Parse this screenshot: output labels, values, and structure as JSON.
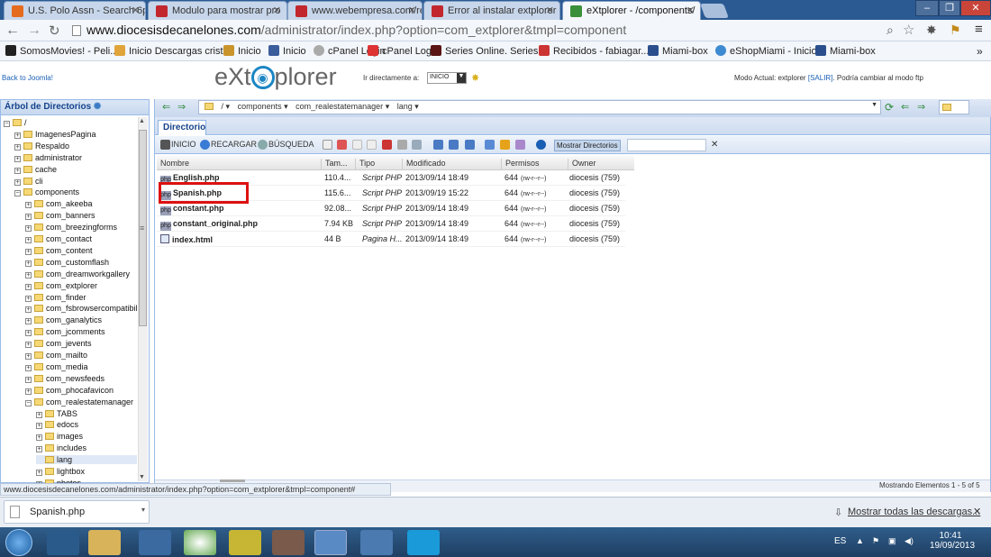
{
  "browser": {
    "tabs": [
      {
        "title": "U.S. Polo Assn - Search 6p",
        "fav_color": "#e56b1f"
      },
      {
        "title": "Modulo para mostrar pro",
        "fav_color": "#c2272d"
      },
      {
        "title": "www.webempresa.com/re",
        "fav_color": "#c2272d"
      },
      {
        "title": "Error al instalar extplorer -",
        "fav_color": "#c2272d"
      },
      {
        "title": "eXtplorer - /components/",
        "fav_color": "#3a8f3a"
      }
    ],
    "url_domain": "www.diocesisdecanelones.com",
    "url_rest": "/administrator/index.php?option=com_extplorer&tmpl=component",
    "bookmarks": [
      "SomosMovies! - Peli...",
      "Inicio Descargas cristo",
      "Inicio",
      "Inicio",
      "cPanel Login",
      "Series Online. Series...",
      "Recibidos - fabiagar...",
      "Miami-box",
      "eShopMiami - Inicio",
      "Miami-box"
    ],
    "overflow": "»"
  },
  "page": {
    "back_link": "Back to Joomla!",
    "logo": {
      "pre": "eXt",
      "o": "◉",
      "post": "plorer"
    },
    "goto_label": "Ir directamente a:",
    "goto_value": "INICIO",
    "mode_text": "Modo Actual: extplorer",
    "mode_salir": "[SALIR]",
    "mode_tail": "Podría cambiar al modo ftp"
  },
  "tree": {
    "title": "Árbol de Directorios",
    "nodes": [
      {
        "label": "/",
        "sign": "−"
      },
      {
        "label": "ImagenesPagina",
        "sign": "+"
      },
      {
        "label": "Respaldo",
        "sign": "+"
      },
      {
        "label": "administrator",
        "sign": "+"
      },
      {
        "label": "cache",
        "sign": "+"
      },
      {
        "label": "cli",
        "sign": "+"
      },
      {
        "label": "components",
        "sign": "−"
      },
      {
        "label": "com_akeeba",
        "sign": "+"
      },
      {
        "label": "com_banners",
        "sign": "+"
      },
      {
        "label": "com_breezingforms",
        "sign": "+"
      },
      {
        "label": "com_contact",
        "sign": "+"
      },
      {
        "label": "com_content",
        "sign": "+"
      },
      {
        "label": "com_customflash",
        "sign": "+"
      },
      {
        "label": "com_dreamworkgallery",
        "sign": "+"
      },
      {
        "label": "com_extplorer",
        "sign": "+"
      },
      {
        "label": "com_finder",
        "sign": "+"
      },
      {
        "label": "com_fsbrowsercompatibility",
        "sign": "+"
      },
      {
        "label": "com_ganalytics",
        "sign": "+"
      },
      {
        "label": "com_jcomments",
        "sign": "+"
      },
      {
        "label": "com_jevents",
        "sign": "+"
      },
      {
        "label": "com_mailto",
        "sign": "+"
      },
      {
        "label": "com_media",
        "sign": "+"
      },
      {
        "label": "com_newsfeeds",
        "sign": "+"
      },
      {
        "label": "com_phocafavicon",
        "sign": "+"
      },
      {
        "label": "com_realestatemanager",
        "sign": "−"
      },
      {
        "label": "TABS",
        "sign": "+"
      },
      {
        "label": "edocs",
        "sign": "+"
      },
      {
        "label": "images",
        "sign": "+"
      },
      {
        "label": "includes",
        "sign": "+"
      },
      {
        "label": "lang",
        "sign": ""
      },
      {
        "label": "lightbox",
        "sign": "+"
      },
      {
        "label": "photos",
        "sign": "+"
      }
    ]
  },
  "breadcrumb": [
    "/",
    "components",
    "com_realestatemanager",
    "lang"
  ],
  "panel_tab": "Directorio",
  "toolbar": {
    "inicio": "INICIO",
    "recargar": "RECARGAR",
    "busqueda": "BÚSQUEDA",
    "mostrar": "Mostrar Directorios"
  },
  "grid": {
    "headers": [
      "Nombre",
      "Tam...",
      "Tipo",
      "Modificado",
      "Permisos",
      "Owner"
    ],
    "rows": [
      {
        "name": "English.php",
        "size": "110.4...",
        "type": "Script PHP",
        "modified": "2013/09/14 18:49",
        "perm": "644",
        "perm_detail": "(rw-r--r--)",
        "owner": "diocesis (759)",
        "icon": "php"
      },
      {
        "name": "Spanish.php",
        "size": "115.6...",
        "type": "Script PHP",
        "modified": "2013/09/19 15:22",
        "perm": "644",
        "perm_detail": "(rw-r--r--)",
        "owner": "diocesis (759)",
        "icon": "php"
      },
      {
        "name": "constant.php",
        "size": "92.08...",
        "type": "Script PHP",
        "modified": "2013/09/14 18:49",
        "perm": "644",
        "perm_detail": "(rw-r--r--)",
        "owner": "diocesis (759)",
        "icon": "php"
      },
      {
        "name": "constant_original.php",
        "size": "7.94 KB",
        "type": "Script PHP",
        "modified": "2013/09/14 18:49",
        "perm": "644",
        "perm_detail": "(rw-r--r--)",
        "owner": "diocesis (759)",
        "icon": "php"
      },
      {
        "name": "index.html",
        "size": "44 B",
        "type": "Pagina H...",
        "modified": "2013/09/14 18:49",
        "perm": "644",
        "perm_detail": "(rw-r--r--)",
        "owner": "diocesis (759)",
        "icon": "html"
      }
    ],
    "icon_label": "php"
  },
  "status_text": "Mostrando Elementos 1 - 5 of 5",
  "hover_url": "www.diocesisdecanelones.com/administrator/index.php?option=com_extplorer&tmpl=component#",
  "downloads": {
    "file": "Spanish.php",
    "show_all": "Mostrar todas las descargas..."
  },
  "taskbar": {
    "lang": "ES",
    "time": "10:41",
    "date": "19/09/2013"
  }
}
